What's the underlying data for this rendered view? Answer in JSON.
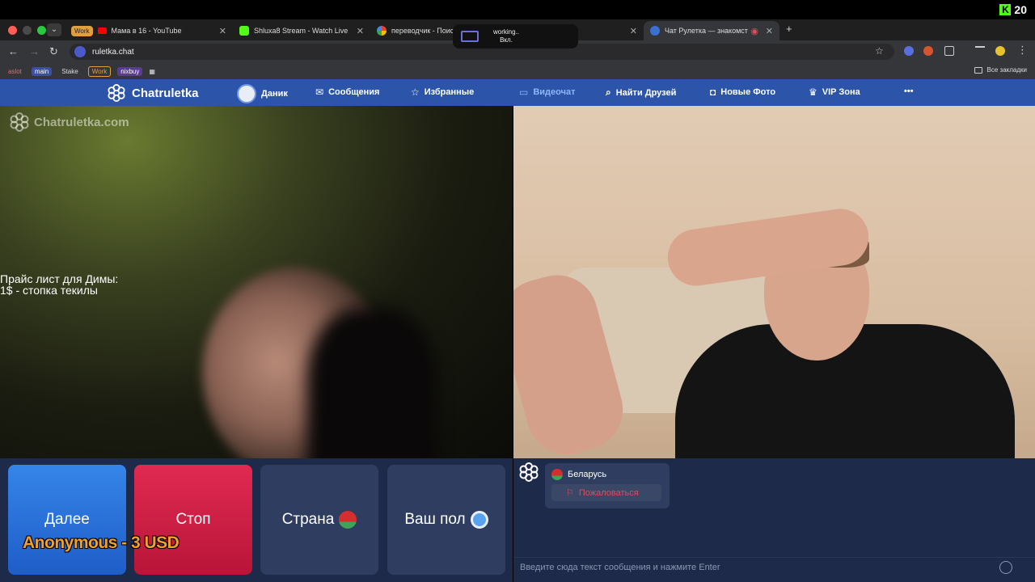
{
  "stream_badge": {
    "logo": "K",
    "count": "20"
  },
  "browser": {
    "tabs": [
      {
        "group": "Work",
        "title": "Мама в 16 - YouTube"
      },
      {
        "title": "Shluxa8 Stream - Watch Live"
      },
      {
        "title": "переводчик - Поиск"
      },
      {
        "title": "Чат Рулетка — знакомст"
      }
    ],
    "notification": {
      "title": "working..",
      "subtitle": "Вкл."
    },
    "url": "ruletka.chat",
    "bookmarks": [
      "aslot",
      "main",
      "Stake",
      "Work",
      "nixbuy"
    ],
    "all_bookmarks": "Все закладки"
  },
  "site": {
    "brand": "Chatruletka",
    "nav": {
      "user": "Даник",
      "messages": "Сообщения",
      "favorites": "Избранные",
      "videochat": "Видеочат",
      "find_friends": "Найти Друзей",
      "new_photos": "Новые Фото",
      "vip": "VIP Зона",
      "more": "•••"
    },
    "watermark": "Chatruletka.com"
  },
  "overlay": {
    "price_line1": "Прайс лист для Димы:",
    "price_line2": "1$ - стопка текилы",
    "donation": "Anonymous - 3 USD"
  },
  "controls": {
    "next": "Далее",
    "stop": "Стоп",
    "country": "Страна",
    "gender": "Ваш пол"
  },
  "chat": {
    "partner_country": "Беларусь",
    "report": "Пожаловаться",
    "input_placeholder": "Введите сюда текст сообщения и нажмите Enter"
  }
}
